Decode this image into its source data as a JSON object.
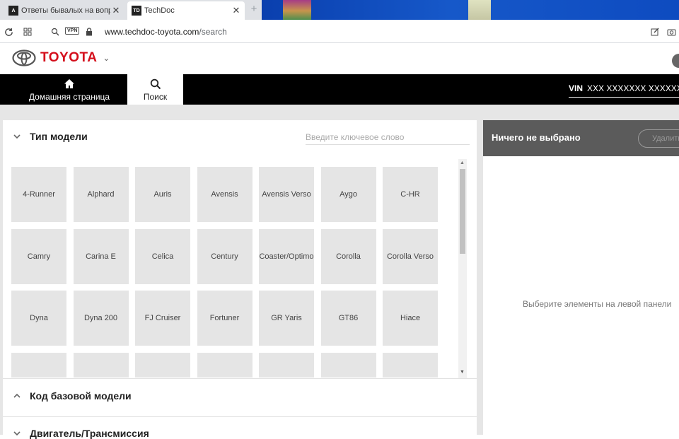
{
  "browser": {
    "tabs": [
      {
        "title": "Ответы бывалых на вопр",
        "favicon": "A"
      },
      {
        "title": "TechDoc",
        "favicon": "TD"
      }
    ],
    "url_host": "www.techdoc-toyota.com",
    "url_path": "/search",
    "vpn_label": "VPN"
  },
  "header": {
    "brand": "TOYOTA"
  },
  "nav": {
    "home_label": "Домашняя страница",
    "search_label": "Поиск",
    "vin_label": "VIN",
    "vin_value": "XXX XXXXXXX XXXXXX"
  },
  "left_panel": {
    "model_type_title": "Тип модели",
    "keyword_placeholder": "Введите ключевое слово",
    "models": [
      "4-Runner",
      "Alphard",
      "Auris",
      "Avensis",
      "Avensis Verso",
      "Aygo",
      "C-HR",
      "Camry",
      "Carina E",
      "Celica",
      "Century",
      "Coaster/Optimo",
      "Corolla",
      "Corolla Verso",
      "Dyna",
      "Dyna 200",
      "FJ Cruiser",
      "Fortuner",
      "GR Yaris",
      "GT86",
      "Hiace",
      "",
      "",
      "",
      "",
      "",
      "",
      ""
    ],
    "base_model_code_title": "Код базовой модели",
    "engine_title": "Двигатель/Трансмиссия"
  },
  "right_panel": {
    "title": "Ничего не выбрано",
    "delete_label": "Удалить",
    "hint": "Выберите элементы на левой панели"
  },
  "colors": {
    "brand_red": "#d40f1c",
    "nav_black": "#000000",
    "panel_header": "#5b5b5b",
    "tile_bg": "#e5e5e5"
  }
}
